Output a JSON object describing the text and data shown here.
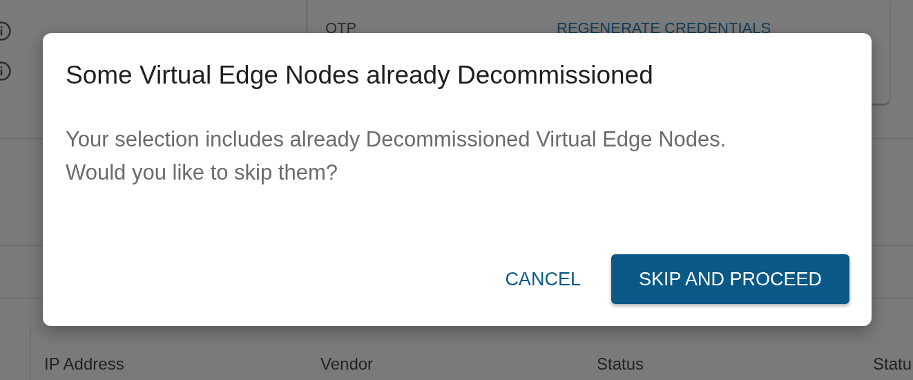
{
  "background": {
    "card": {
      "label": "OTP",
      "action": "REGENERATE CREDENTIALS"
    },
    "info_icons": [
      {
        "kind": "info"
      },
      {
        "kind": "info"
      }
    ],
    "table": {
      "columns": [
        "IP Address",
        "Vendor",
        "Status",
        "Statu"
      ]
    }
  },
  "dialog": {
    "title": "Some Virtual Edge Nodes already Decommissioned",
    "message": [
      "Your selection includes already Decommissioned Virtual Edge Nodes.",
      "Would you like to skip them?"
    ],
    "buttons": [
      {
        "label": "CANCEL",
        "kind": "text"
      },
      {
        "label": "SKIP AND PROCEED",
        "kind": "primary"
      }
    ]
  }
}
